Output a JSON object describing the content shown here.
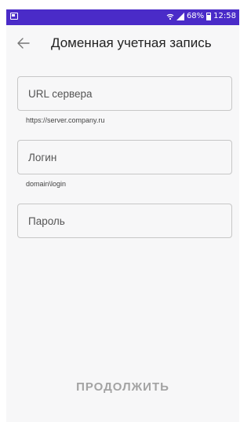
{
  "status_bar": {
    "battery": "68%",
    "time": "12:58",
    "icons": [
      "image-notification-icon",
      "wifi-icon",
      "signal-icon",
      "battery-icon"
    ],
    "color": "#4a2bc8"
  },
  "toolbar": {
    "title": "Доменная учетная запись",
    "back_icon": "arrow-left-icon"
  },
  "form": {
    "server_url": {
      "placeholder": "URL сервера",
      "value": "",
      "helper": "https://server.company.ru"
    },
    "login": {
      "placeholder": "Логин",
      "value": "",
      "helper": "domain\\login"
    },
    "password": {
      "placeholder": "Пароль",
      "value": ""
    }
  },
  "continue_label": "ПРОДОЛЖИТЬ",
  "continue_enabled": false
}
